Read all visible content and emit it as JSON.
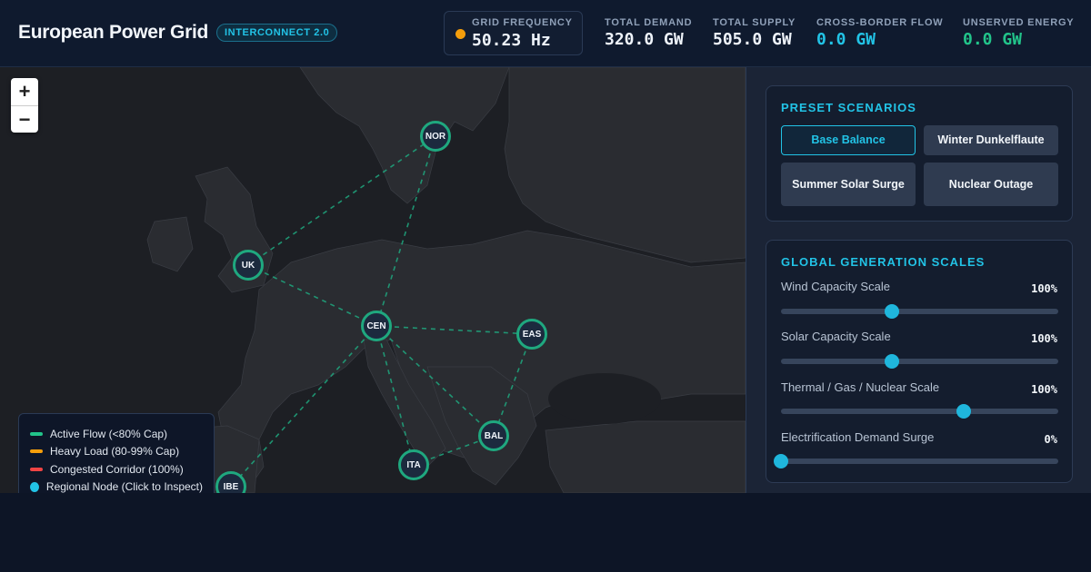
{
  "header": {
    "title": "European Power Grid",
    "badge": "INTERCONNECT 2.0",
    "metrics": {
      "frequency": {
        "label": "GRID FREQUENCY",
        "value": "50.23 Hz",
        "status_color": "#f59e0b"
      },
      "demand": {
        "label": "TOTAL DEMAND",
        "value": "320.0 GW"
      },
      "supply": {
        "label": "TOTAL SUPPLY",
        "value": "505.0 GW"
      },
      "flow": {
        "label": "CROSS-BORDER FLOW",
        "value": "0.0 GW"
      },
      "unserved": {
        "label": "UNSERVED ENERGY",
        "value": "0.0 GW"
      }
    }
  },
  "map": {
    "zoom_in": "+",
    "zoom_out": "−",
    "nodes": [
      {
        "id": "NOR",
        "label": "NOR"
      },
      {
        "id": "UK",
        "label": "UK"
      },
      {
        "id": "CEN",
        "label": "CEN"
      },
      {
        "id": "EAS",
        "label": "EAS"
      },
      {
        "id": "BAL",
        "label": "BAL"
      },
      {
        "id": "ITA",
        "label": "ITA"
      },
      {
        "id": "IBE",
        "label": "IBE"
      }
    ],
    "legend": [
      {
        "label": "Active Flow (<80% Cap)",
        "color": "#22c48a"
      },
      {
        "label": "Heavy Load (80-99% Cap)",
        "color": "#f59e0b"
      },
      {
        "label": "Congested Corridor (100%)",
        "color": "#ef4444"
      },
      {
        "label": "Regional Node (Click to Inspect)",
        "color": "#22c3e6"
      }
    ]
  },
  "scenarios": {
    "title": "PRESET SCENARIOS",
    "buttons": [
      {
        "label": "Base Balance",
        "active": true
      },
      {
        "label": "Winter Dunkelflaute",
        "active": false
      },
      {
        "label": "Summer Solar Surge",
        "active": false
      },
      {
        "label": "Nuclear Outage",
        "active": false
      }
    ]
  },
  "scales": {
    "title": "GLOBAL GENERATION SCALES",
    "sliders": [
      {
        "label": "Wind Capacity Scale",
        "value": "100%",
        "level": 0.4
      },
      {
        "label": "Solar Capacity Scale",
        "value": "100%",
        "level": 0.4
      },
      {
        "label": "Thermal / Gas / Nuclear Scale",
        "value": "100%",
        "level": 0.66
      },
      {
        "label": "Electrification Demand Surge",
        "value": "0%",
        "level": 0.0
      }
    ]
  },
  "colors": {
    "accent": "#22c3e6",
    "node_ring": "#1fa87f",
    "flow_line": "#1fa87f"
  }
}
